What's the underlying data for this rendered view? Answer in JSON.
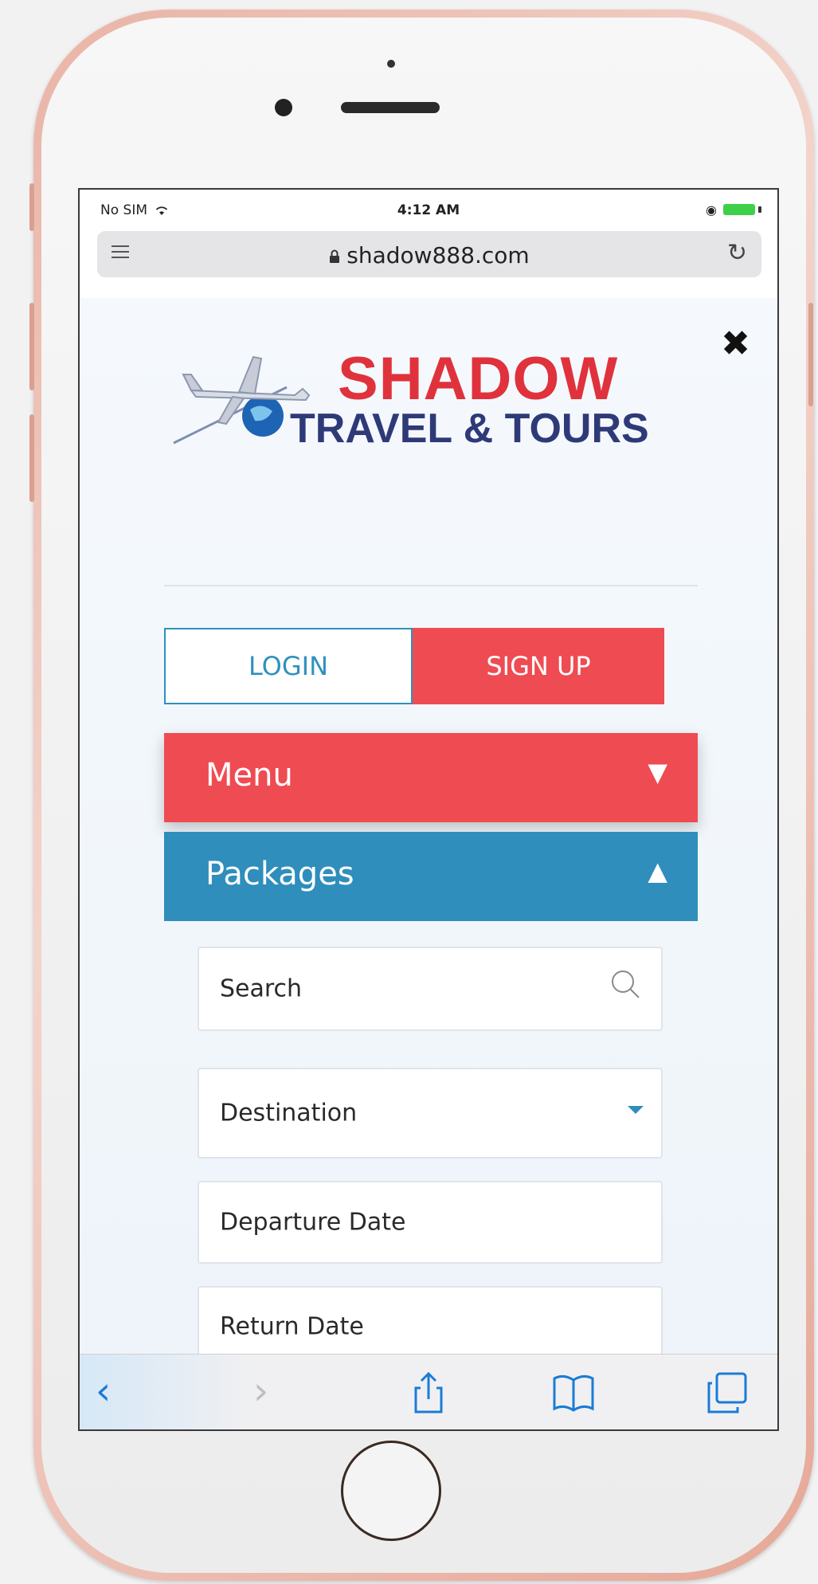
{
  "status": {
    "carrier": "No SIM",
    "time": "4:12 AM"
  },
  "browser": {
    "url": "shadow888.com"
  },
  "logo": {
    "line1": "SHADOW",
    "line2": "TRAVEL & TOURS"
  },
  "auth": {
    "login_label": "LOGIN",
    "signup_label": "SIGN UP"
  },
  "nav": {
    "menu_label": "Menu",
    "menu_arrow": "▼",
    "packages_label": "Packages",
    "packages_arrow": "▲"
  },
  "form": {
    "search_placeholder": "Search",
    "destination_label": "Destination",
    "departure_label": "Departure Date",
    "return_label": "Return Date"
  },
  "toolbar": {
    "back_glyph": "‹",
    "forward_glyph": "›"
  },
  "colors": {
    "brand_red": "#ef4b52",
    "brand_blue": "#2f8ebb",
    "logo_navy": "#2e3a78"
  }
}
